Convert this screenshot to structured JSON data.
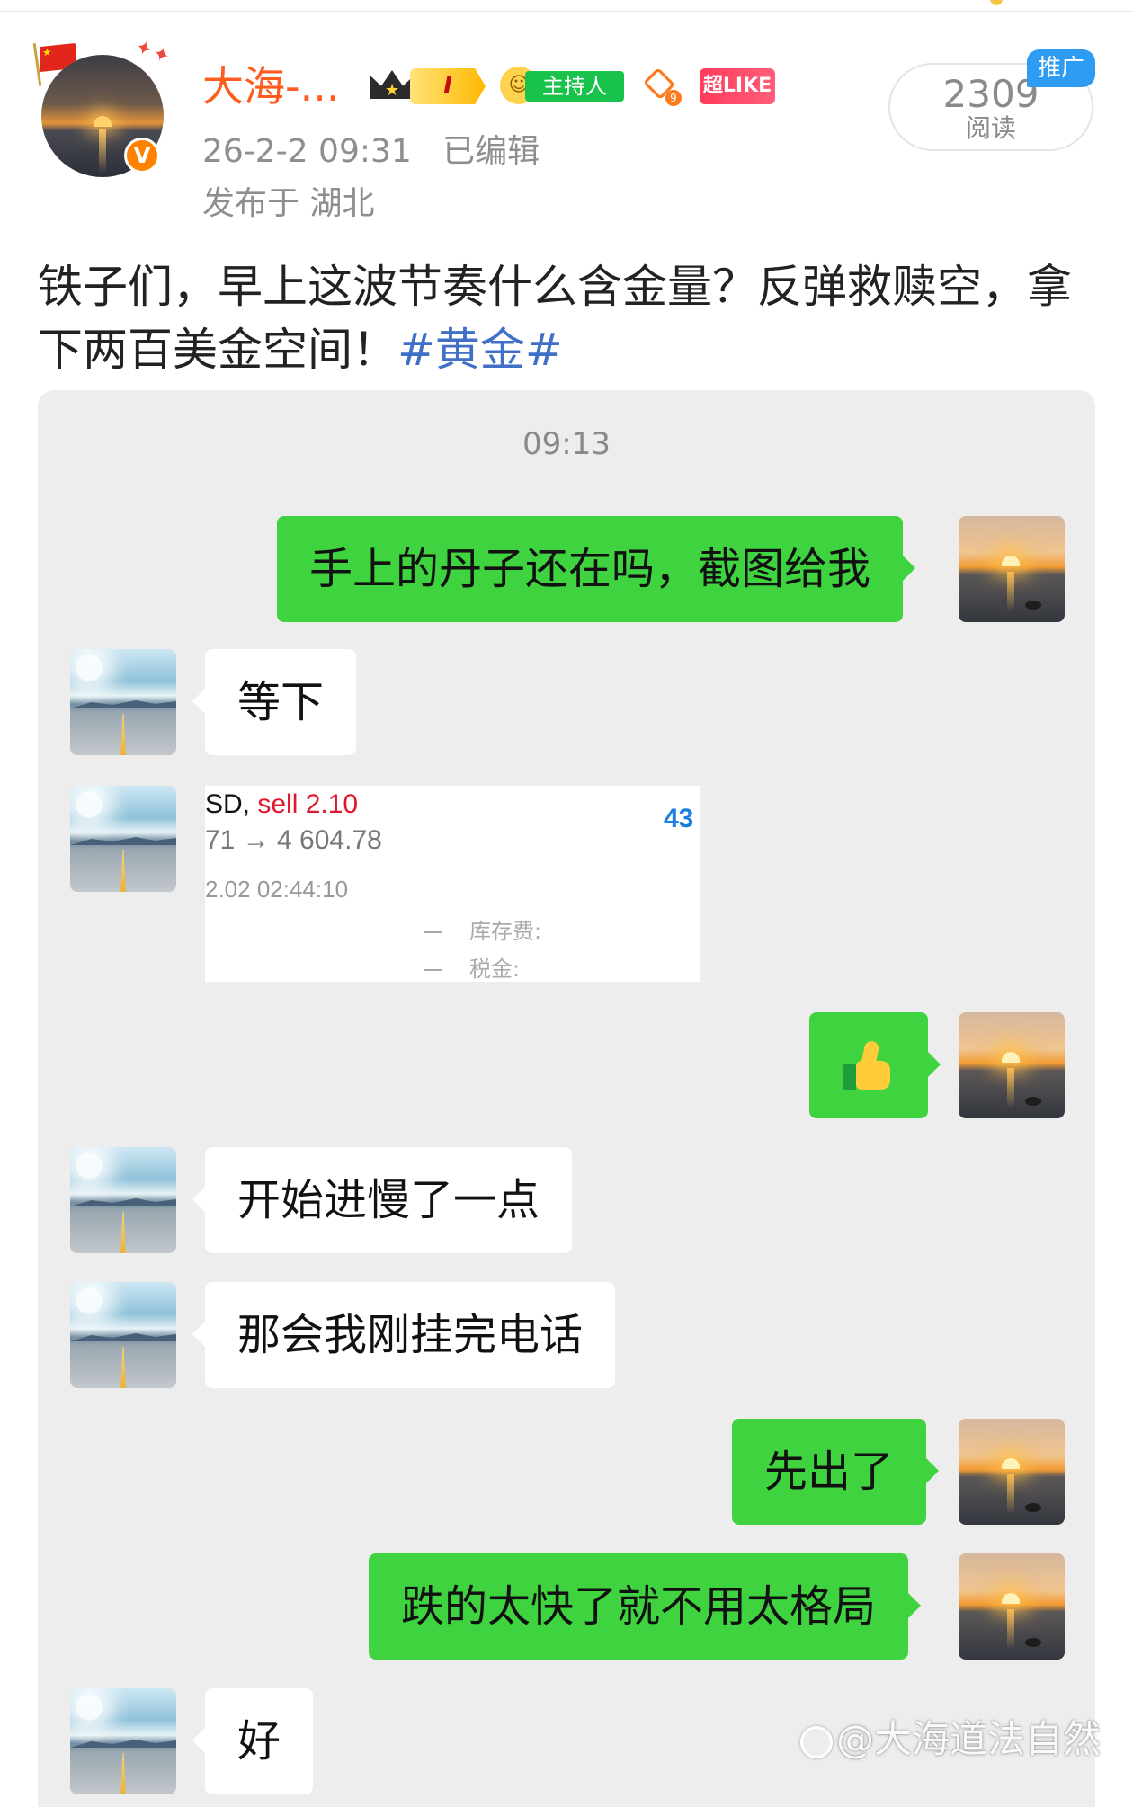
{
  "post_header": {
    "username": "大海-...",
    "level": "I",
    "host_badge": "主持人",
    "diamond_level": "9",
    "superlike_badge": "超LIKE",
    "timestamp": "26-2-2 09:31",
    "edited": "已编辑",
    "location": "发布于 湖北",
    "verified_mark": "V",
    "flag_star": "★"
  },
  "read_stat": {
    "count": "2309",
    "label": "阅读",
    "promo": "推广"
  },
  "post": {
    "text": "铁子们，早上这波节奏什么含金量？反弹救赎空，拿下两百美金空间！",
    "hashtag": "#黄金#"
  },
  "chat": {
    "time": "09:13",
    "messages": [
      {
        "side": "right",
        "text": "手上的丹子还在吗，截图给我"
      },
      {
        "side": "left",
        "text": "等下"
      },
      {
        "side": "left",
        "type": "image"
      },
      {
        "side": "right",
        "type": "emoji",
        "emoji": "thumbs-up"
      },
      {
        "side": "left",
        "text": "开始进慢了一点"
      },
      {
        "side": "left",
        "text": "那会我刚挂完电话"
      },
      {
        "side": "right",
        "text": "先出了"
      },
      {
        "side": "right",
        "text": "跌的太快了就不用太格局"
      },
      {
        "side": "left",
        "text": "好"
      }
    ],
    "trade_card": {
      "symbol": "SD,",
      "side_label": "sell 2.10",
      "prices": "71 → 4 604.78",
      "number": "43",
      "datetime": "2.02 02:44:10",
      "swap_label": "库存费:",
      "tax_label": "税金:"
    }
  },
  "watermark": "@大海道法自然",
  "colors": {
    "username": "#ff5c1f",
    "my_bubble": "#3fd33f",
    "their_bubble": "#ffffff",
    "hashtag": "#3f6fc6",
    "sell": "#e0182d",
    "chat_bg": "#ededed"
  }
}
